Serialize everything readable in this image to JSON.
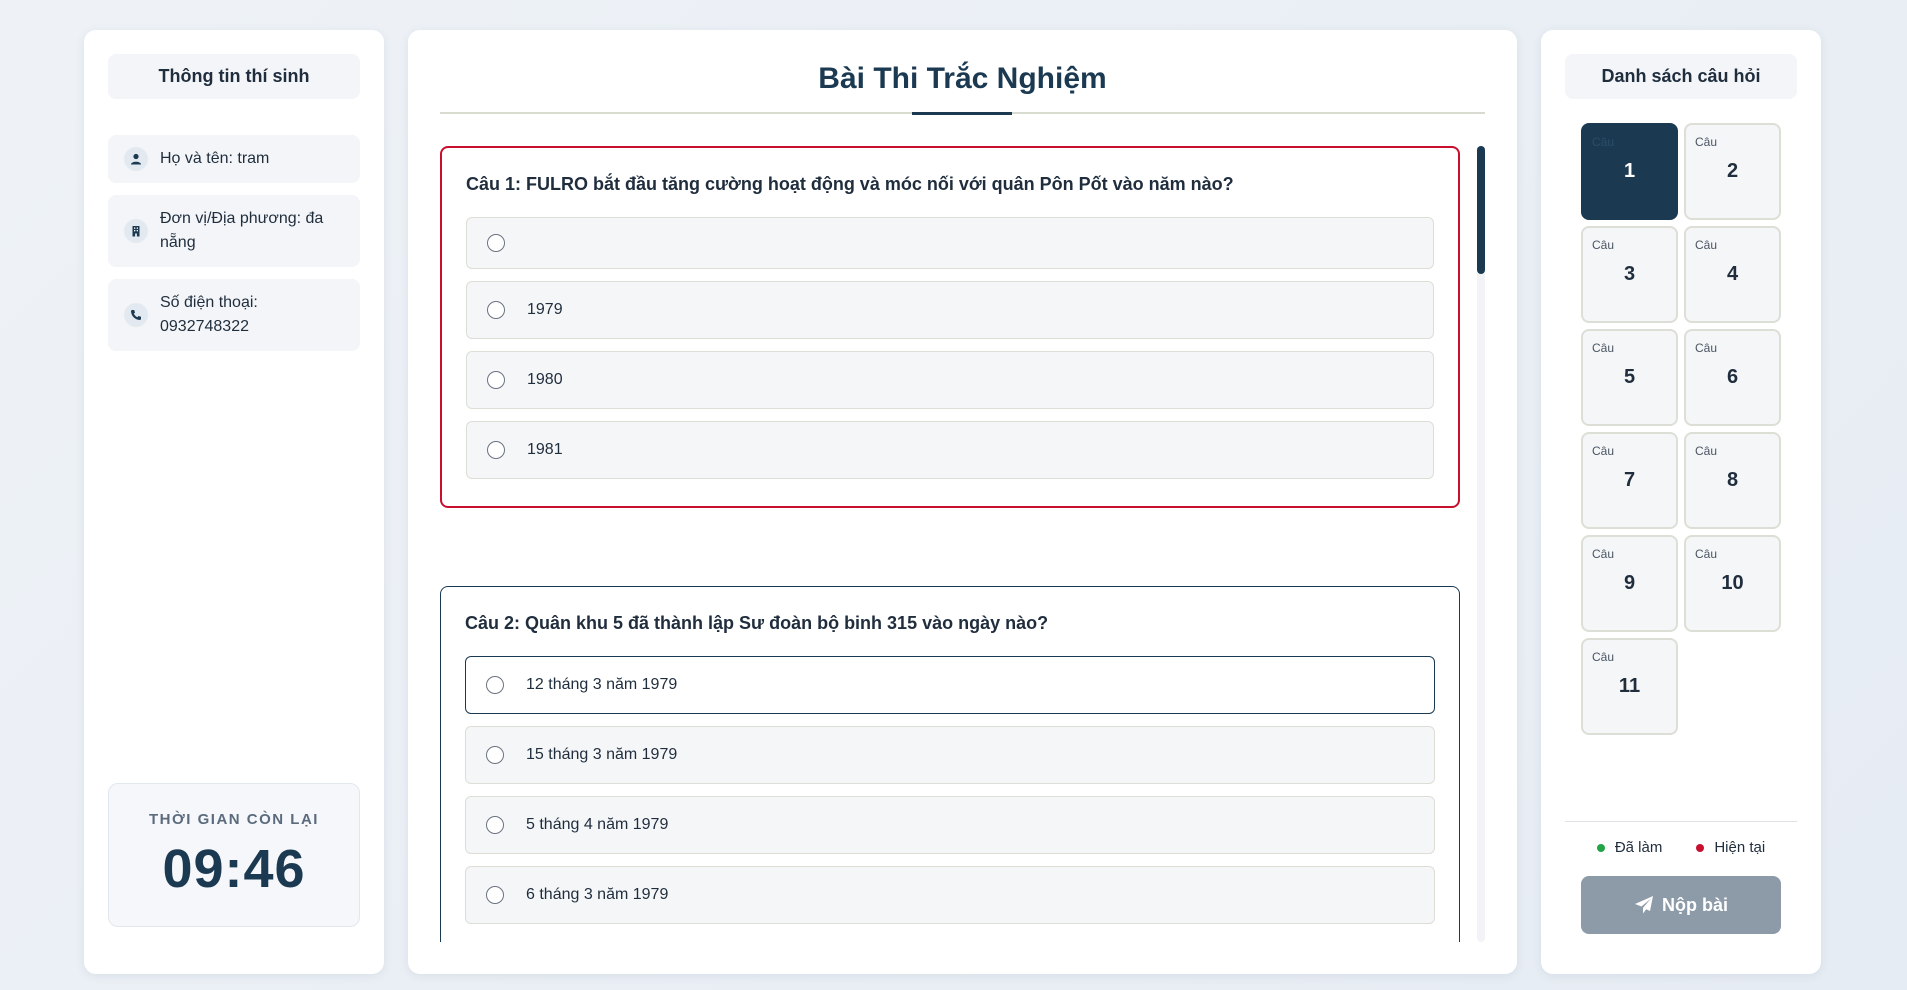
{
  "candidate": {
    "title": "Thông tin thí sinh",
    "name": "Họ và tên: tram",
    "unit": "Đơn vị/Địa phương: đa nẵng",
    "phone": "Số điện thoại: 0932748322",
    "icons": [
      "user-icon",
      "building-icon",
      "phone-icon"
    ]
  },
  "timer": {
    "label": "THỜI GIAN CÒN LẠI",
    "value": "09:46"
  },
  "exam": {
    "title": "Bài Thi Trắc Nghiệm",
    "questions": [
      {
        "text": "Câu 1: FULRO bắt đầu tăng cường hoạt động và móc nối với quân Pôn Pốt vào năm nào?",
        "options": [
          "",
          "1979",
          "1980",
          "1981"
        ]
      },
      {
        "text": "Câu 2: Quân khu 5 đã thành lập Sư đoàn bộ binh 315 vào ngày nào?",
        "options": [
          "12 tháng 3 năm 1979",
          "15 tháng 3 năm 1979",
          "5 tháng 4 năm 1979",
          "6 tháng 3 năm 1979"
        ]
      }
    ]
  },
  "question_list": {
    "title": "Danh sách câu hỏi",
    "caption": "Câu",
    "numbers": [
      "1",
      "2",
      "3",
      "4",
      "5",
      "6",
      "7",
      "8",
      "9",
      "10",
      "11"
    ],
    "current": "1"
  },
  "legend": {
    "done": "Đã làm",
    "current": "Hiện tại",
    "done_color": "#22a447",
    "current_color": "#c8102e"
  },
  "submit": {
    "label": "Nộp bài",
    "icon": "paper-plane-icon"
  },
  "colors": {
    "primary": "#1b3a52",
    "danger": "#c8102e",
    "submit_disabled": "#8d9aa7"
  }
}
